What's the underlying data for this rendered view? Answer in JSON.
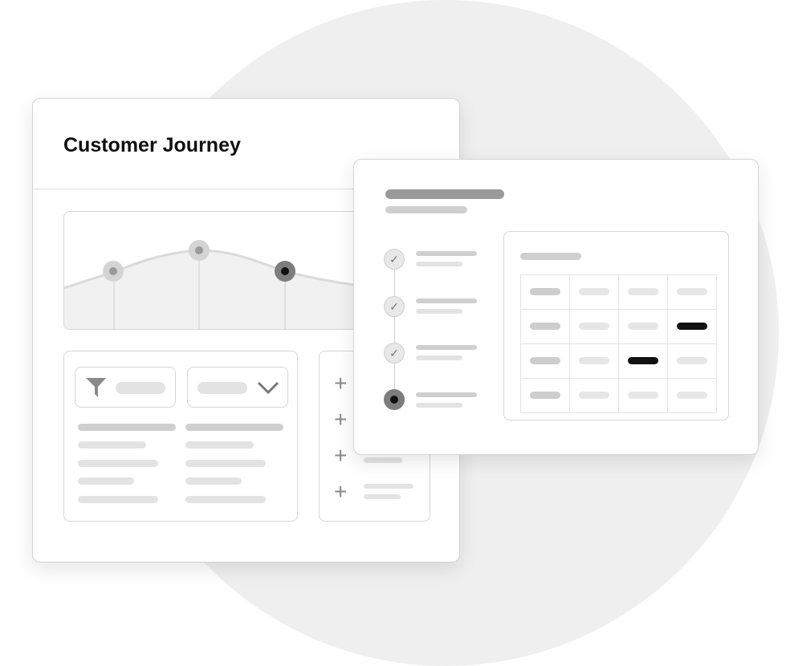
{
  "card": {
    "title": "Customer Journey"
  },
  "icons": {
    "filter": "filter-icon",
    "dropdown": "chevron-down-icon",
    "add": "plus-icon",
    "check": "check-icon"
  },
  "colors": {
    "accent": "#111111",
    "muted": "#9a9a9a",
    "background_circle": "#efefef"
  }
}
